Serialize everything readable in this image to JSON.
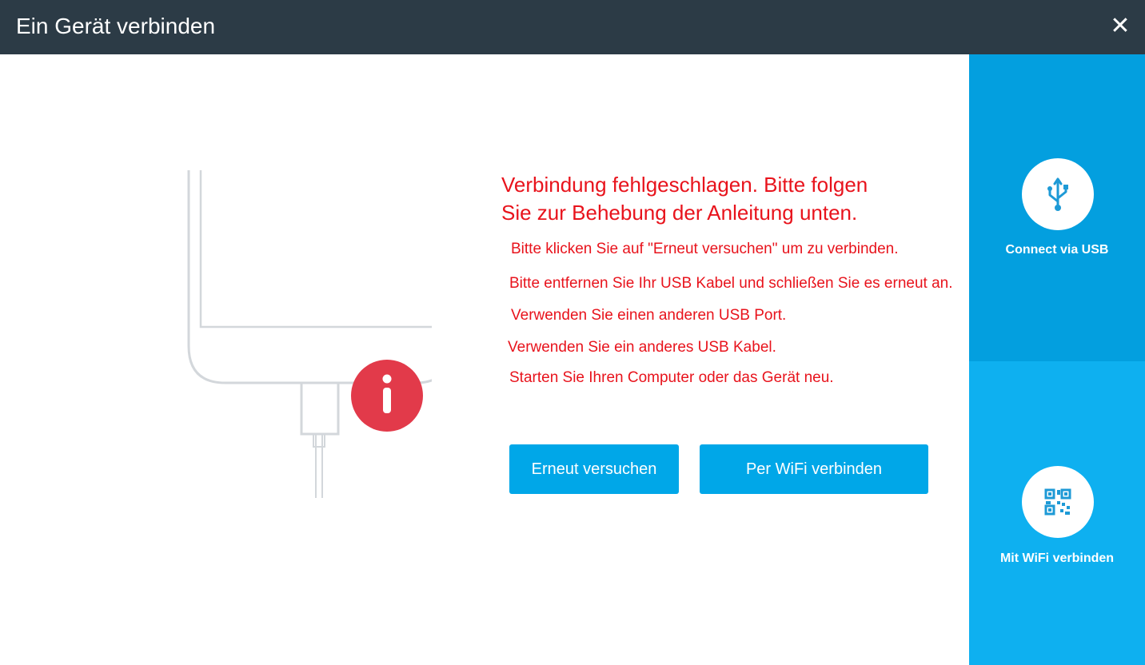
{
  "window": {
    "title": "Ein Gerät verbinden",
    "close_symbol": "✕"
  },
  "main": {
    "headline_line1": "Verbindung fehlgeschlagen. Bitte folgen",
    "headline_line2": "Sie zur Behebung der Anleitung unten.",
    "steps": [
      "Bitte klicken Sie auf \"Erneut versuchen\" um zu verbinden.",
      "Bitte entfernen Sie Ihr USB Kabel und schließen Sie es erneut an.",
      "Verwenden Sie einen anderen USB Port.",
      "Verwenden Sie ein anderes USB Kabel.",
      "Starten Sie Ihren Computer oder das Gerät neu."
    ],
    "retry_button": "Erneut versuchen",
    "wifi_button": "Per WiFi verbinden",
    "info_badge": "i"
  },
  "sidebar": {
    "usb_label": "Connect via USB",
    "wifi_label": "Mit WiFi verbinden"
  },
  "icons": {
    "usb": "usb-icon",
    "qr": "qr-code-icon",
    "info": "info-icon",
    "phone": "phone-illustration"
  },
  "colors": {
    "titlebar": "#2c3b46",
    "error_text": "#e8131c",
    "button": "#00a7e8",
    "sidebar_usb": "#039fdf",
    "sidebar_wifi": "#0eb0f0",
    "info_badge": "#e23a4a"
  }
}
